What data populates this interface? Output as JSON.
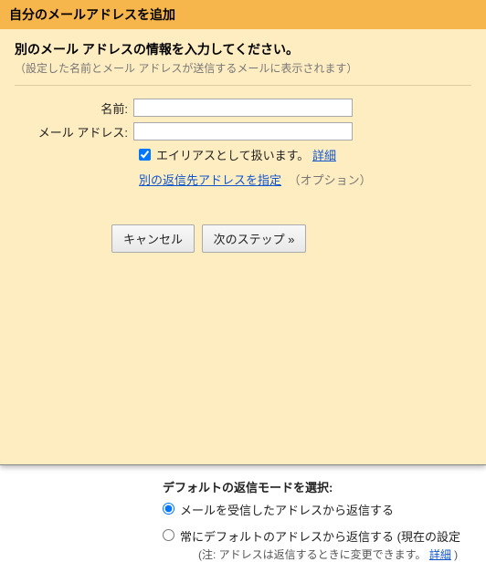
{
  "dialog": {
    "title": "自分のメールアドレスを追加",
    "instruction": "別のメール アドレスの情報を入力してください。",
    "subtext": "（設定した名前とメール アドレスが送信するメールに表示されます）",
    "form": {
      "name_label": "名前:",
      "name_value": "",
      "email_label": "メール アドレス:",
      "email_value": "",
      "alias_checkbox_label": "エイリアスとして扱います。",
      "alias_checked": true,
      "details_link": "詳細",
      "reply_link": "別の返信先アドレスを指定",
      "reply_option": "（オプション）"
    },
    "buttons": {
      "cancel": "キャンセル",
      "next": "次のステップ »"
    }
  },
  "background": {
    "section_title": "デフォルトの返信モードを選択:",
    "option1": "メールを受信したアドレスから返信する",
    "option2": "常にデフォルトのアドレスから返信する (現在の設定",
    "note_prefix": "(注: アドレスは返信するときに変更できます。",
    "note_link": "詳細",
    "note_suffix": ")"
  }
}
